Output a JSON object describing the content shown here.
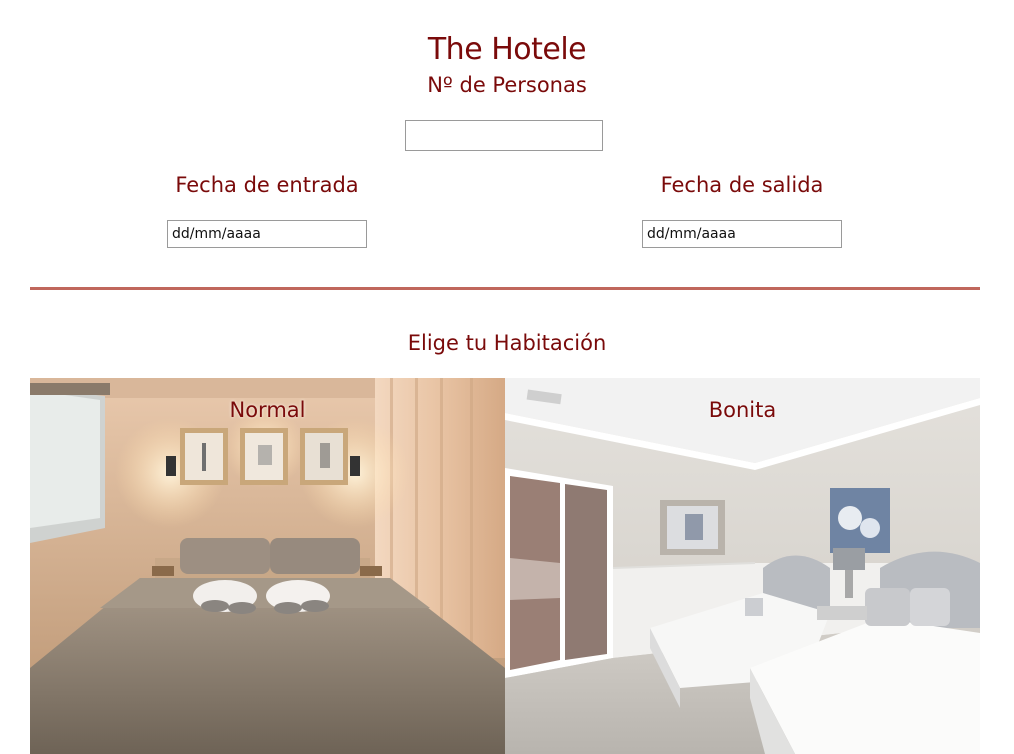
{
  "page": {
    "title": "The Hotele",
    "persons_label": "Nº de Personas",
    "persons_value": ""
  },
  "dates": {
    "checkin_label": "Fecha de entrada",
    "checkin_placeholder": "dd/mm/aaaa",
    "checkout_label": "Fecha de salida",
    "checkout_placeholder": "dd/mm/aaaa"
  },
  "rooms": {
    "heading": "Elige tu Habitación",
    "items": [
      {
        "name": "Normal",
        "photo": "warm-bedroom-photo"
      },
      {
        "name": "Bonita",
        "photo": "twin-bedroom-photo"
      }
    ]
  },
  "colors": {
    "accent": "#7a0a0a",
    "divider": "#c0675c"
  }
}
